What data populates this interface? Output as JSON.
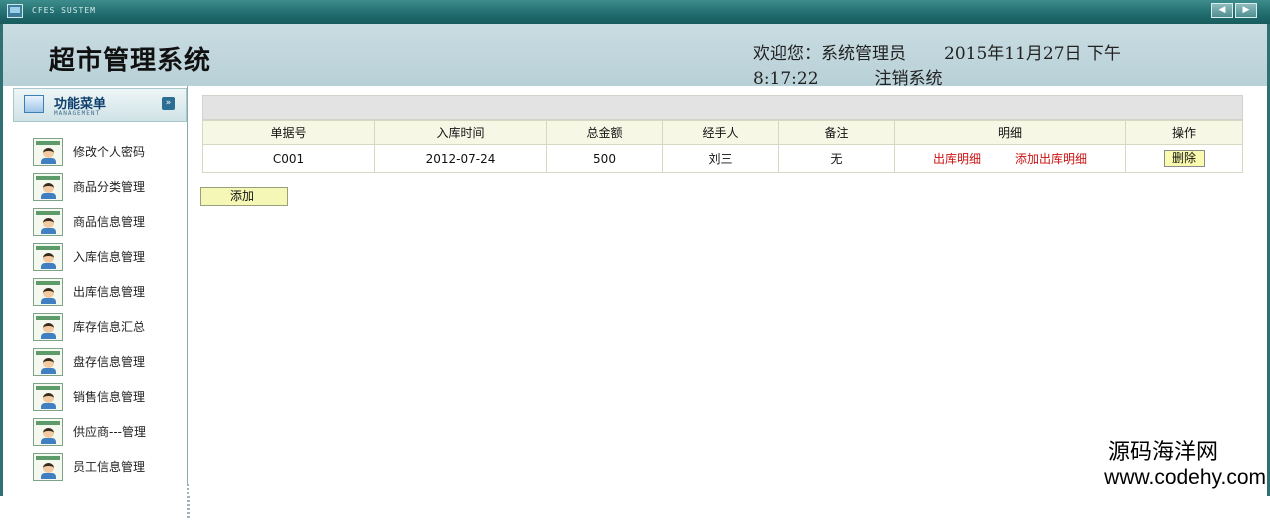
{
  "window": {
    "title": "CFES SUSTEM"
  },
  "header": {
    "title": "超市管理系统",
    "welcome_prefix": "欢迎您：系统管理员",
    "datetime_date": "2015年11月27日 下午",
    "datetime_time": "8:17:22",
    "logout_label": "注销系统"
  },
  "sidebar": {
    "title": "功能菜单",
    "subtitle": "MANAGEMENT",
    "items": [
      {
        "label": "修改个人密码"
      },
      {
        "label": "商品分类管理"
      },
      {
        "label": "商品信息管理"
      },
      {
        "label": "入库信息管理"
      },
      {
        "label": "出库信息管理"
      },
      {
        "label": "库存信息汇总"
      },
      {
        "label": "盘存信息管理"
      },
      {
        "label": "销售信息管理"
      },
      {
        "label": "供应商---管理"
      },
      {
        "label": "员工信息管理"
      }
    ]
  },
  "table": {
    "columns": [
      "单据号",
      "入库时间",
      "总金额",
      "经手人",
      "备注",
      "明细",
      "操作"
    ],
    "rows": [
      {
        "id": "C001",
        "date": "2012-07-24",
        "amount": "500",
        "handler": "刘三",
        "remark": "无",
        "detail_link": "出库明细",
        "add_detail_link": "添加出库明细",
        "delete_label": "删除"
      }
    ]
  },
  "actions": {
    "add_label": "添加"
  },
  "watermark": {
    "name": "源码海洋网",
    "url": "www.codehy.com"
  },
  "colors": {
    "frame": "#2f7173",
    "header_bg": "#c9dde2",
    "link_red": "#cc1111",
    "button_yellow": "#f4f7b6"
  }
}
